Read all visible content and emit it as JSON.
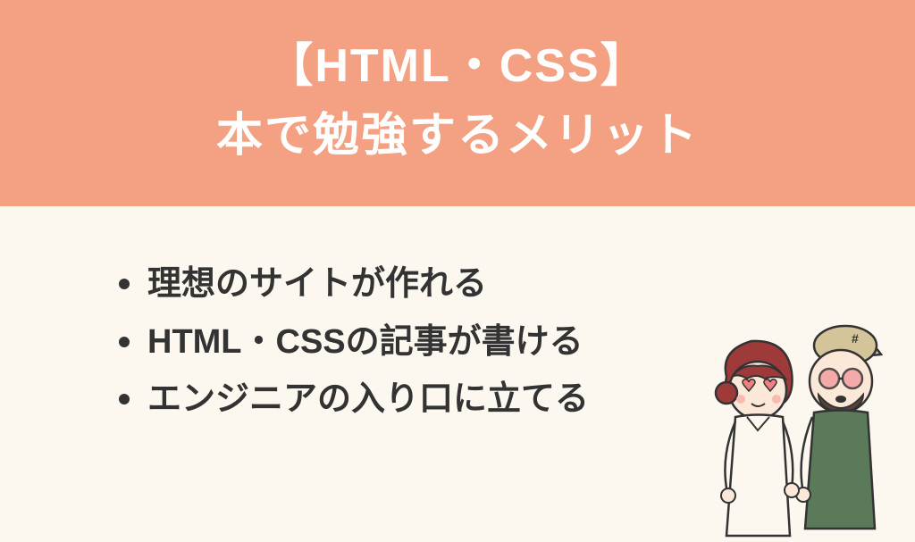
{
  "header": {
    "line1": "【HTML・CSS】",
    "line2": "本で勉強するメリット"
  },
  "bullets": {
    "item1": "理想のサイトが作れる",
    "item2": "HTML・CSSの記事が書ける",
    "item3": "エンジニアの入り口に立てる"
  },
  "colors": {
    "headerBg": "#f4a082",
    "bodyBg": "#fdf8ef",
    "headerText": "#ffffff",
    "bodyText": "#333333"
  }
}
